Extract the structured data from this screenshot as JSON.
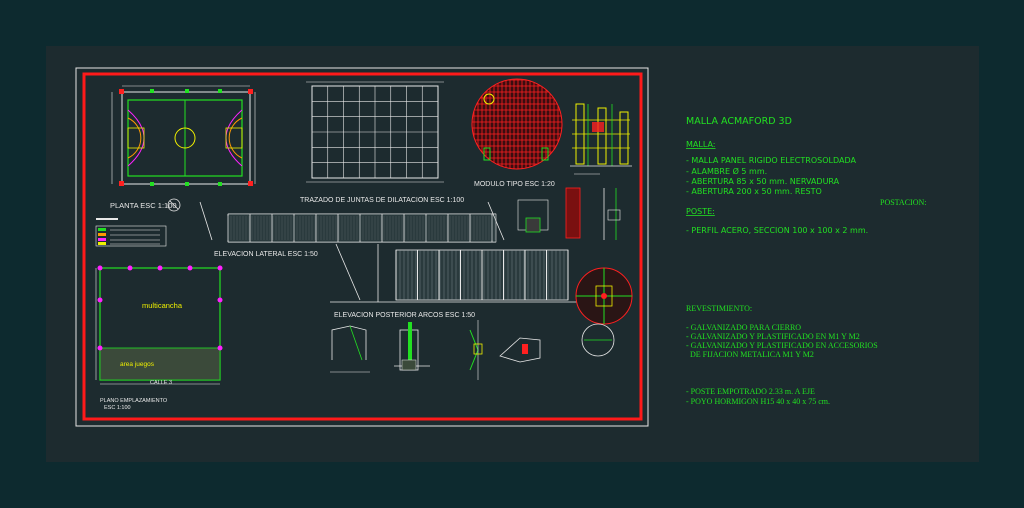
{
  "colors": {
    "outer_bg": "#0d2a2f",
    "model_space": "#1d2b2f",
    "frame": "#e6e6e6",
    "border_red": "#ff1a1a",
    "line_white": "#e8e8e8",
    "green": "#22e022",
    "yellow": "#f0f000",
    "red": "#ff2020",
    "magenta": "#ff22ff",
    "cyan": "#20e0e0",
    "orange": "#ff9a00"
  },
  "drawing": {
    "court_plan_title": "PLANTA ESC 1:100",
    "joints_title": "TRAZADO DE JUNTAS DE DILATACION ESC 1:100",
    "module_title": "MODULO TIPO ESC 1:20",
    "side_elevation_title": "ELEVACION LATERAL ESC 1:50",
    "rear_elevation_title": "ELEVACION POSTERIOR ARCOS ESC 1:50",
    "site_label": "multicancha",
    "area_label": "area juegos",
    "street_label": "CALLE 3",
    "site_plan_title": "PLANO EMPLAZAMIENTO",
    "site_plan_scale": "ESC 1:100"
  },
  "notes": {
    "title": "MALLA ACMAFORD 3D",
    "mesh_heading": "MALLA:",
    "mesh_items": [
      "- MALLA PANEL RIGIDO ELECTROSOLDADA",
      "- ALAMBRE Ø 5 mm.",
      "- ABERTURA 85 x 50 mm. NERVADURA",
      "- ABERTURA 200 x 50 mm. RESTO"
    ],
    "post_heading": "POSTACION:",
    "post_heading_underline": "POSTE:",
    "post_items": [
      "- PERFIL ACERO, SECCION 100 x 100 x 2 mm."
    ],
    "coating_heading": "REVESTIMIENTO:",
    "coating_items": [
      "- GALVANIZADO PARA CIERRO",
      "- GALVANIZADO Y PLASTIFICADO EN M1 Y M2",
      "- GALVANIZADO Y PLASTIFICADO EN ACCESORIOS",
      "  DE FIJACION METALICA M1 Y M2"
    ],
    "foundation_items": [
      "- POSTE EMPOTRADO 2.33 m. A EJE",
      "- POYO HORMIGON H15 40 x 40 x 75 cm."
    ]
  }
}
